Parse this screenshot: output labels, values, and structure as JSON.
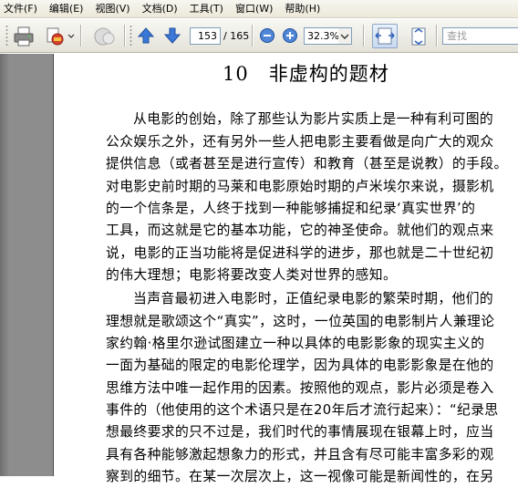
{
  "menu": [
    "文件(F)",
    "编辑(E)",
    "视图(V)",
    "文档(D)",
    "工具(T)",
    "窗口(W)",
    "帮助(H)"
  ],
  "toolbar": {
    "current_page": "153",
    "total_pages": "/ 165",
    "zoom": "32.3%",
    "search_placeholder": "查找"
  },
  "document": {
    "chapter_title": "10　非虚构的题材",
    "lines": [
      "从电影的创始，除了那些认为影片实质上是一种有利可图的",
      "公众娱乐之外，还有另外一些人把电影主要看做是向广大的观众",
      "提供信息（或者甚至是进行宣传）和教育（甚至是说教）的手段。",
      "对电影史前时期的马莱和电影原始时期的卢米埃尔来说，摄影机",
      "的一个信条是，人终于找到一种能够捕捉和纪录‘真实世界’的",
      "工具，而这就是它的基本功能，它的神圣使命。就他们的观点来",
      "说，电影的正当功能将是促进科学的进步，那也就是二十世纪初",
      "的伟大理想；电影将要改变人类对世界的感知。",
      "当声音最初进入电影时，正值纪录电影的繁荣时期，他们的",
      "理想就是歌颂这个“真实”，这时，一位英国的电影制片人兼理论",
      "家约翰·格里尔逊试图建立一种以具体的电影影象的现实主义的",
      "一面为基础的限定的电影伦理学，因为具体的电影影象是在他的",
      "思维方法中唯一起作用的因素。按照他的观点，影片必须是卷入",
      "事件的（他使用的这个术语只是在20年后才流行起来）：“纪录思",
      "想最终要求的只不过是，我们时代的事情展现在银幕上时，应当",
      "具有各种能够激起想象力的形式，并且含有尽可能丰富多彩的观",
      "察到的细节。在某一次层次上，这一视像可能是新闻性的，在另"
    ]
  }
}
